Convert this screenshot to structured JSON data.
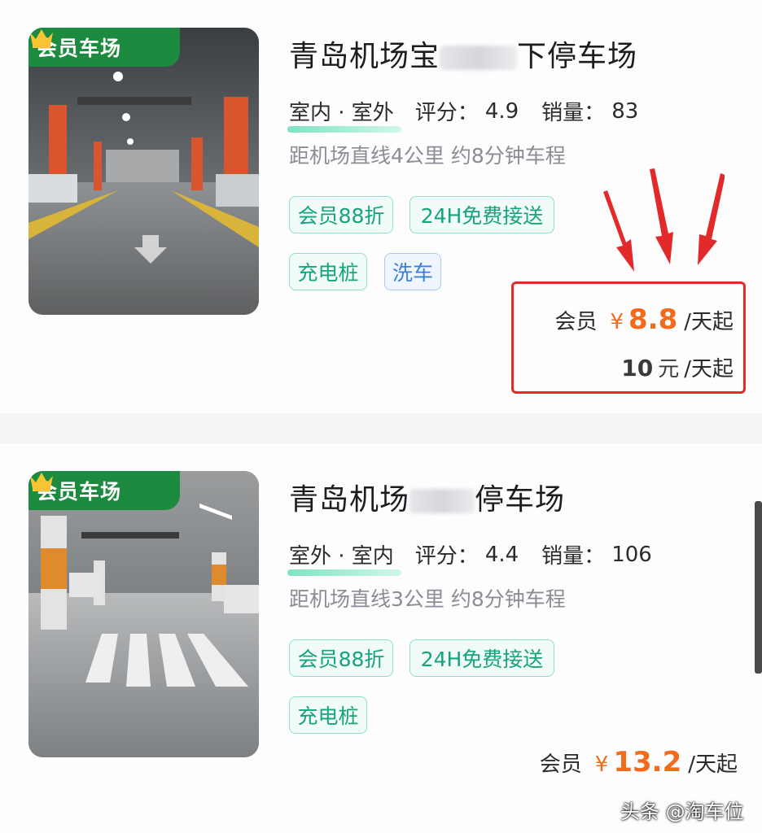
{
  "lots": [
    {
      "badge": "会员车场",
      "title_start": "青岛机场宝",
      "title_end": "下停车场",
      "location_type": "室内 · 室外",
      "rating_label": "评分：",
      "rating": "4.9",
      "sales_label": "销量：",
      "sales": "83",
      "distance": "距机场直线4公里 约8分钟车程",
      "tags": [
        "会员88折",
        "24H免费接送",
        "充电桩",
        "洗车"
      ],
      "member_label": "会员",
      "currency": "¥",
      "member_price": "8.8",
      "unit": "/天起",
      "orig_price": "10",
      "orig_currency": "元",
      "orig_unit": "/天起"
    },
    {
      "badge": "会员车场",
      "title_start": "青岛机场",
      "title_end": "停车场",
      "location_type": "室外 · 室内",
      "rating_label": "评分：",
      "rating": "4.4",
      "sales_label": "销量：",
      "sales": "106",
      "distance": "距机场直线3公里 约8分钟车程",
      "tags": [
        "会员88折",
        "24H免费接送",
        "充电桩"
      ],
      "member_label": "会员",
      "currency": "¥",
      "member_price": "13.2",
      "unit": "/天起"
    }
  ],
  "watermark": "头条 @淘车位",
  "colors": {
    "accent_orange": "#f26a1b",
    "badge_green": "#1c8a3f",
    "highlight_red": "#e32a2a",
    "tag_green": "#17a37d",
    "tag_blue": "#3a7fd8"
  }
}
